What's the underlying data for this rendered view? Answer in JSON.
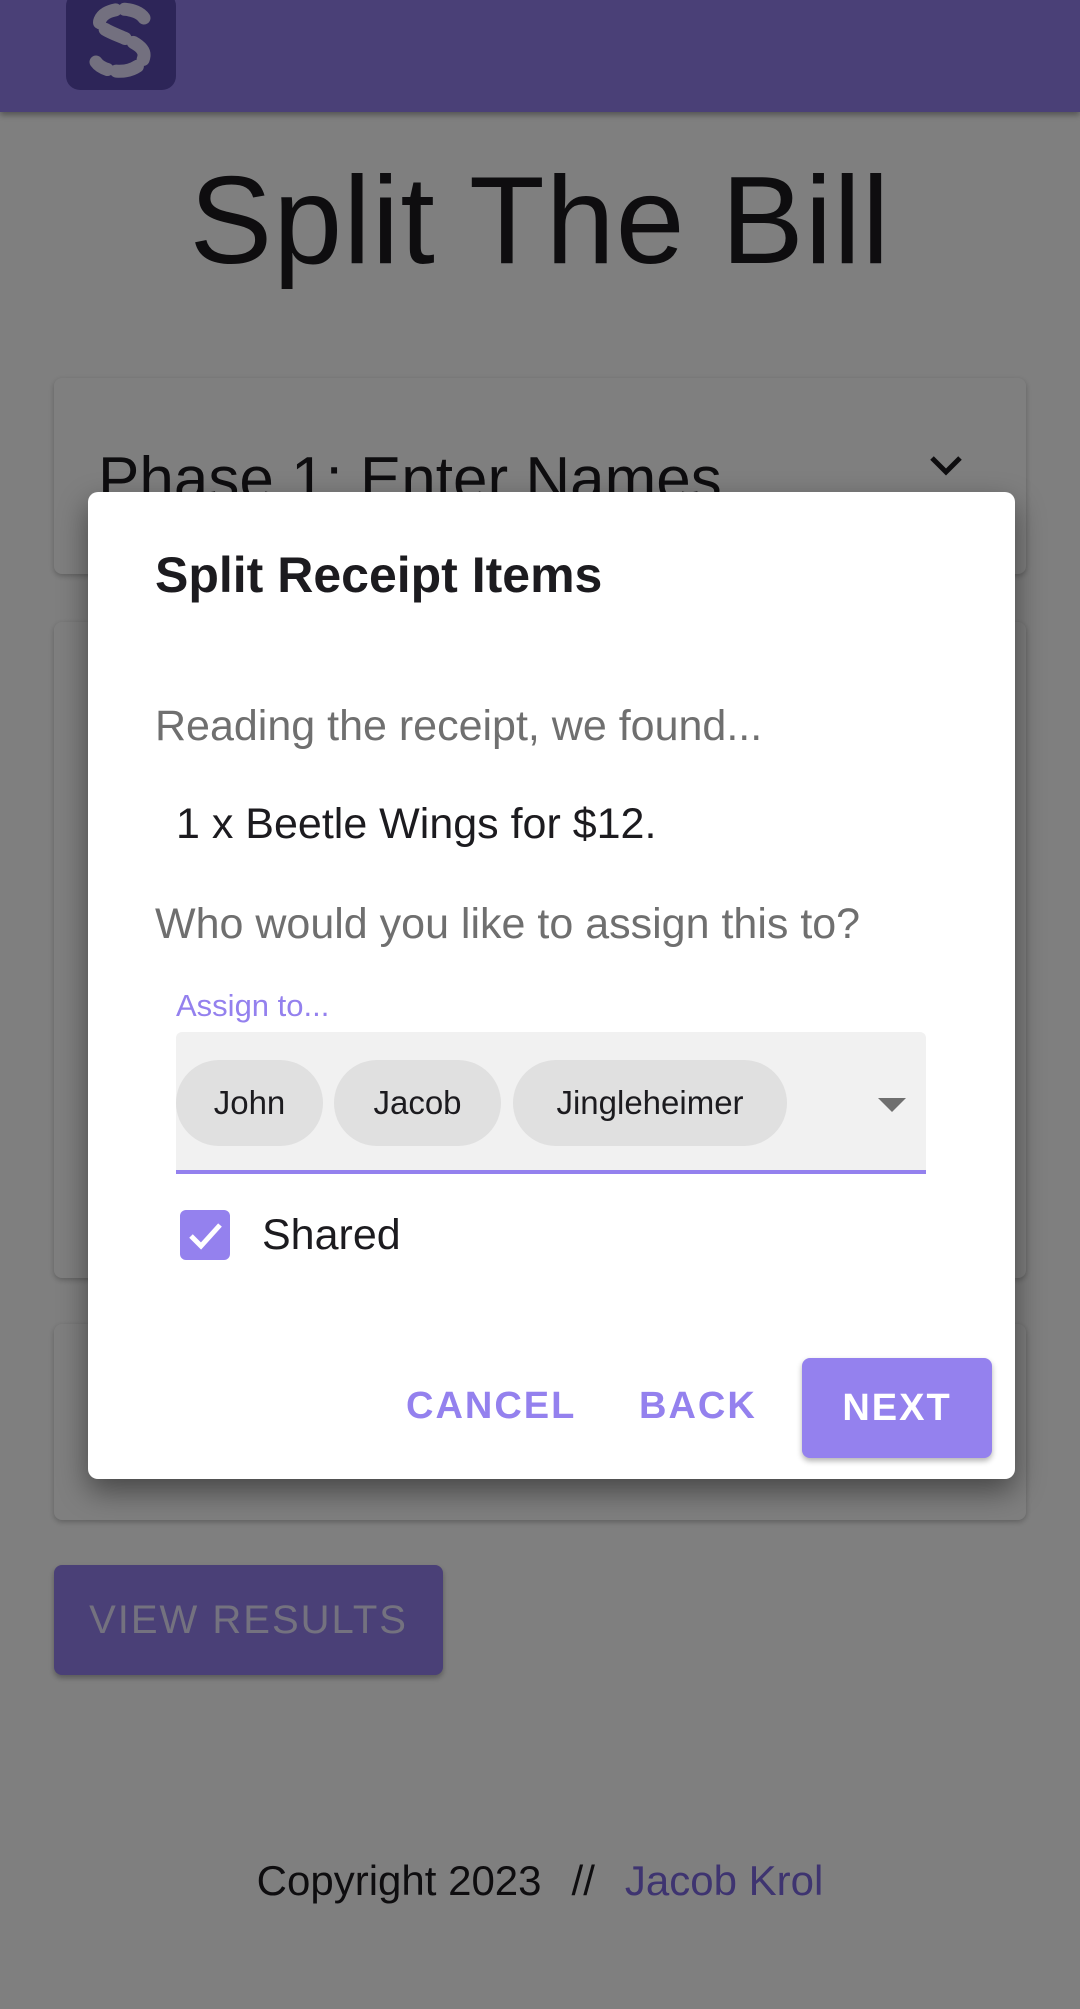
{
  "app": {
    "title": "Split The Bill",
    "accent_color": "#9481ee",
    "logo_icon": "split-s-logo-icon"
  },
  "phases": [
    {
      "title": "Phase 1: Enter Names",
      "icon": "chevron-down-icon"
    }
  ],
  "view_results_label": "VIEW RESULTS",
  "footer": {
    "copyright": "Copyright 2023",
    "separator": "//",
    "author": "Jacob Krol"
  },
  "dialog": {
    "title": "Split Receipt Items",
    "intro": "Reading the receipt, we found...",
    "item": "1 x Beetle Wings for $12.",
    "question": "Who would you like to assign this to?",
    "assign_label": "Assign to...",
    "assignees": [
      "John",
      "Jacob",
      "Jingleheimer"
    ],
    "shared_label": "Shared",
    "shared_checked": true,
    "cancel_label": "CANCEL",
    "back_label": "BACK",
    "next_label": "NEXT"
  }
}
